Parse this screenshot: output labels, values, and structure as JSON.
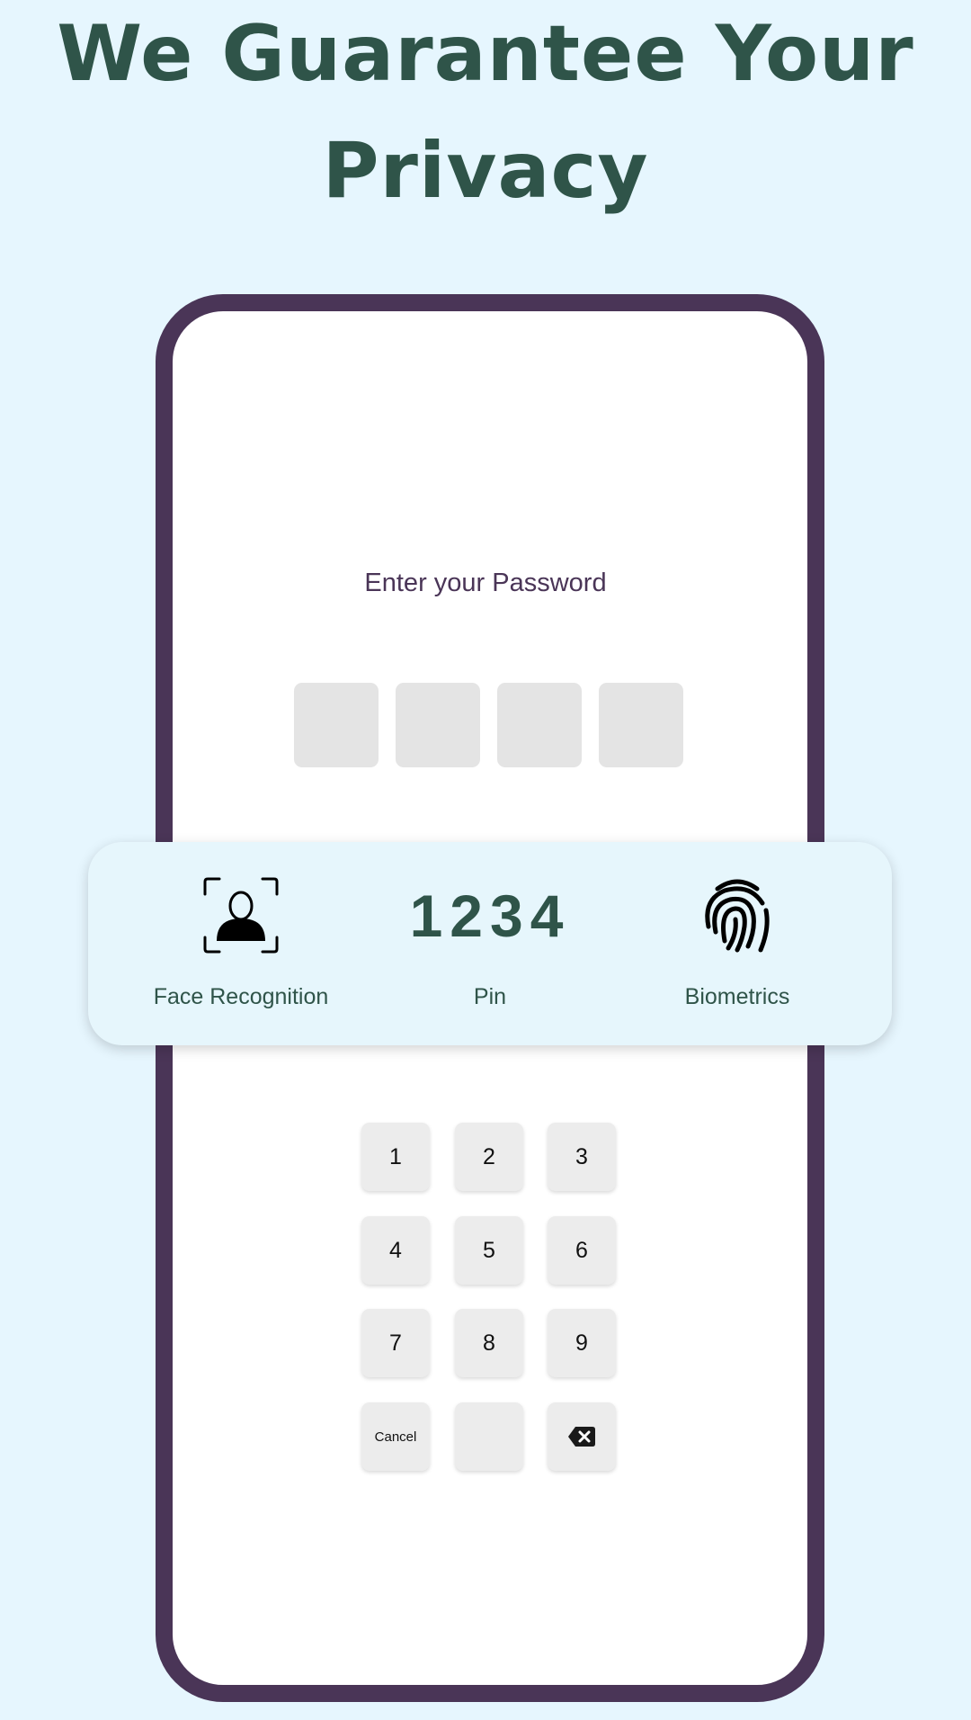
{
  "headline": {
    "line1": "We Guarantee Your",
    "line2": "Privacy"
  },
  "screen": {
    "prompt": "Enter your Password",
    "pin_boxes": 4,
    "options": [
      {
        "label": "Face Recognition",
        "icon": "face-scan-icon"
      },
      {
        "label": "Pin",
        "display": "1234"
      },
      {
        "label": "Biometrics",
        "icon": "fingerprint-icon"
      }
    ],
    "keypad": [
      "1",
      "2",
      "3",
      "4",
      "5",
      "6",
      "7",
      "8",
      "9",
      "Cancel",
      "",
      "backspace-icon"
    ]
  },
  "colors": {
    "background": "#e6f6fe",
    "headline": "#2f5449",
    "phone_frame": "#4a3557",
    "card": "#e6f6fc"
  }
}
